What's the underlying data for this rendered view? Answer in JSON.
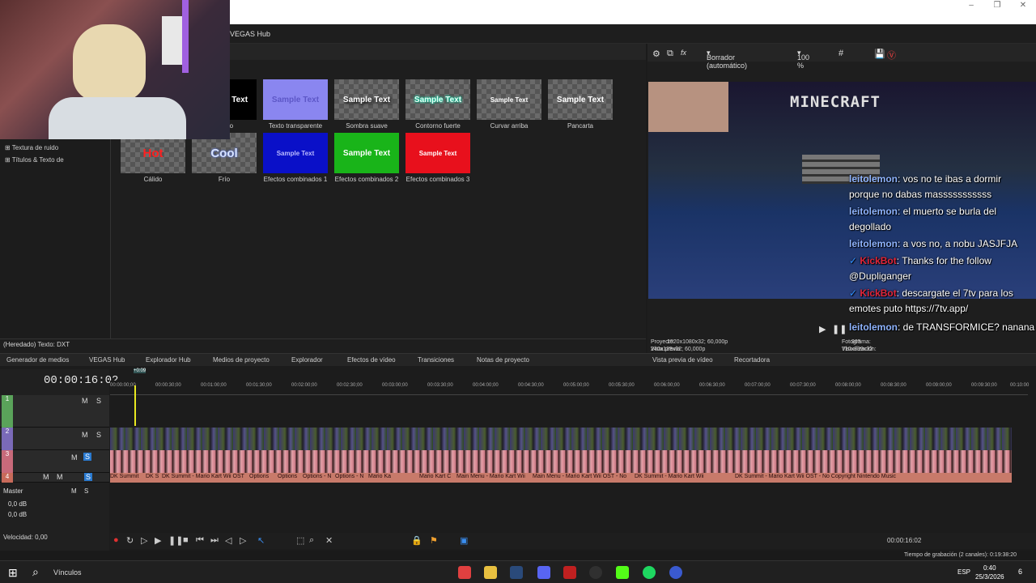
{
  "window": {
    "minimize": "–",
    "maximize": "❐",
    "close": "✕"
  },
  "menu": {
    "hub_label": "VEGAS Hub"
  },
  "media_generator": {
    "presets_row1": [
      {
        "label": "Sólido",
        "text": "Sample Text"
      },
      {
        "label": "Texto transparente",
        "text": "Sample Text"
      },
      {
        "label": "Sombra suave",
        "text": "Sample Text"
      },
      {
        "label": "Contorno fuerte",
        "text": "Sample Text"
      },
      {
        "label": "Curvar arriba",
        "text": "Sample Text"
      },
      {
        "label": "Pancarta",
        "text": "Sample Text"
      }
    ],
    "presets_row2": [
      {
        "label": "Cálido",
        "text": "Hot"
      },
      {
        "label": "Frío",
        "text": "Cool"
      },
      {
        "label": "Efectos combinados 1",
        "text": "Sample Text"
      },
      {
        "label": "Efectos combinados 2",
        "text": "Sample Text"
      },
      {
        "label": "Efectos combinados 3",
        "text": "Sample Text"
      }
    ],
    "tree_items": [
      "Textura de ruido",
      "Títulos & Texto de"
    ],
    "status": "(Heredado) Texto: DXT"
  },
  "tabs": [
    "Generador de medios",
    "VEGAS Hub",
    "Explorador Hub",
    "Medios de proyecto",
    "Explorador",
    "Efectos de vídeo",
    "Transiciones",
    "Notas de proyecto"
  ],
  "preview_tabs": [
    "Vista previa de vídeo",
    "Recortadora"
  ],
  "preview": {
    "mode": "Borrador (automático)",
    "zoom": "100 %",
    "game_title": "MINECRAFT",
    "info": {
      "proyecto_label": "Proyecto:",
      "proyecto": "1920x1080x32; 60,000p",
      "vista_label": "Vista previa:",
      "vista": "240x135x32; 60,000p",
      "fotograma_label": "Fotograma:",
      "fotograma": "965",
      "visualizacion_label": "Visualización:",
      "visualizacion": "710x399x32"
    }
  },
  "chat": [
    {
      "user": "leitolemon",
      "msg": ": vos no te ibas a dormir"
    },
    {
      "user": "",
      "msg": "porque no dabas masssssssssss"
    },
    {
      "user": "leitolemon",
      "msg": ": el muerto se burla del"
    },
    {
      "user": "",
      "msg": "degollado"
    },
    {
      "user": "leitolemon",
      "msg": ": a vos no, a nobu JASJFJA"
    },
    {
      "user": "KickBot",
      "msg": ": Thanks for the follow"
    },
    {
      "user": "",
      "msg": "@Dupliganger"
    },
    {
      "user": "KickBot",
      "msg": ": descargate el 7tv para los"
    },
    {
      "user": "",
      "msg": "emotes puto https://7tv.app/"
    },
    {
      "user": "leitolemon",
      "msg": ": de TRANSFORMICE? nanana"
    }
  ],
  "timeline": {
    "timecode": "00:00:16:02",
    "marker": "+0:09",
    "ruler": [
      "00:00:00;00",
      "00:00:30;00",
      "00:01:00;00",
      "00:01:30;00",
      "00:02:00;00",
      "00:02:30;00",
      "00:03:00;00",
      "00:03:30;00",
      "00:04:00;00",
      "00:04:30;00",
      "00:05:00;00",
      "00:05:30;00",
      "00:06:00;00",
      "00:06:30;00",
      "00:07:00;00",
      "00:07:30;00",
      "00:08:00;00",
      "00:08:30;00",
      "00:09:00;00",
      "00:09:30;00",
      "00:10:00"
    ],
    "clips": [
      "DK Summit",
      "DK S",
      "DK Summit - Mario Kart Wii OST",
      "Options",
      "Options",
      "Options - N",
      "Options - N",
      "Mario Ka",
      "Mario Kart C",
      "Main Menu - Mario Kart Wii",
      "Main Menu - Mario Kart Wii OST - No",
      "DK Summit - Mario Kart Wii",
      "DK Summit - Mario Kart Wii OST - No Copyright Nintendo Music"
    ],
    "master_label": "Master",
    "db1": "0,0 dB",
    "db2": "0,0 dB",
    "velocidad": "Velocidad: 0,00",
    "end_time": "00:00:16:02",
    "rec_time": "Tiempo de grabación (2 canales): 0:19:38:20",
    "track_numbers": [
      "1",
      "2",
      "3",
      "4"
    ]
  },
  "taskbar": {
    "search": "Vínculos",
    "lang": "ESP",
    "time": "0:40",
    "date": "25/3/2026",
    "notif": "6"
  }
}
